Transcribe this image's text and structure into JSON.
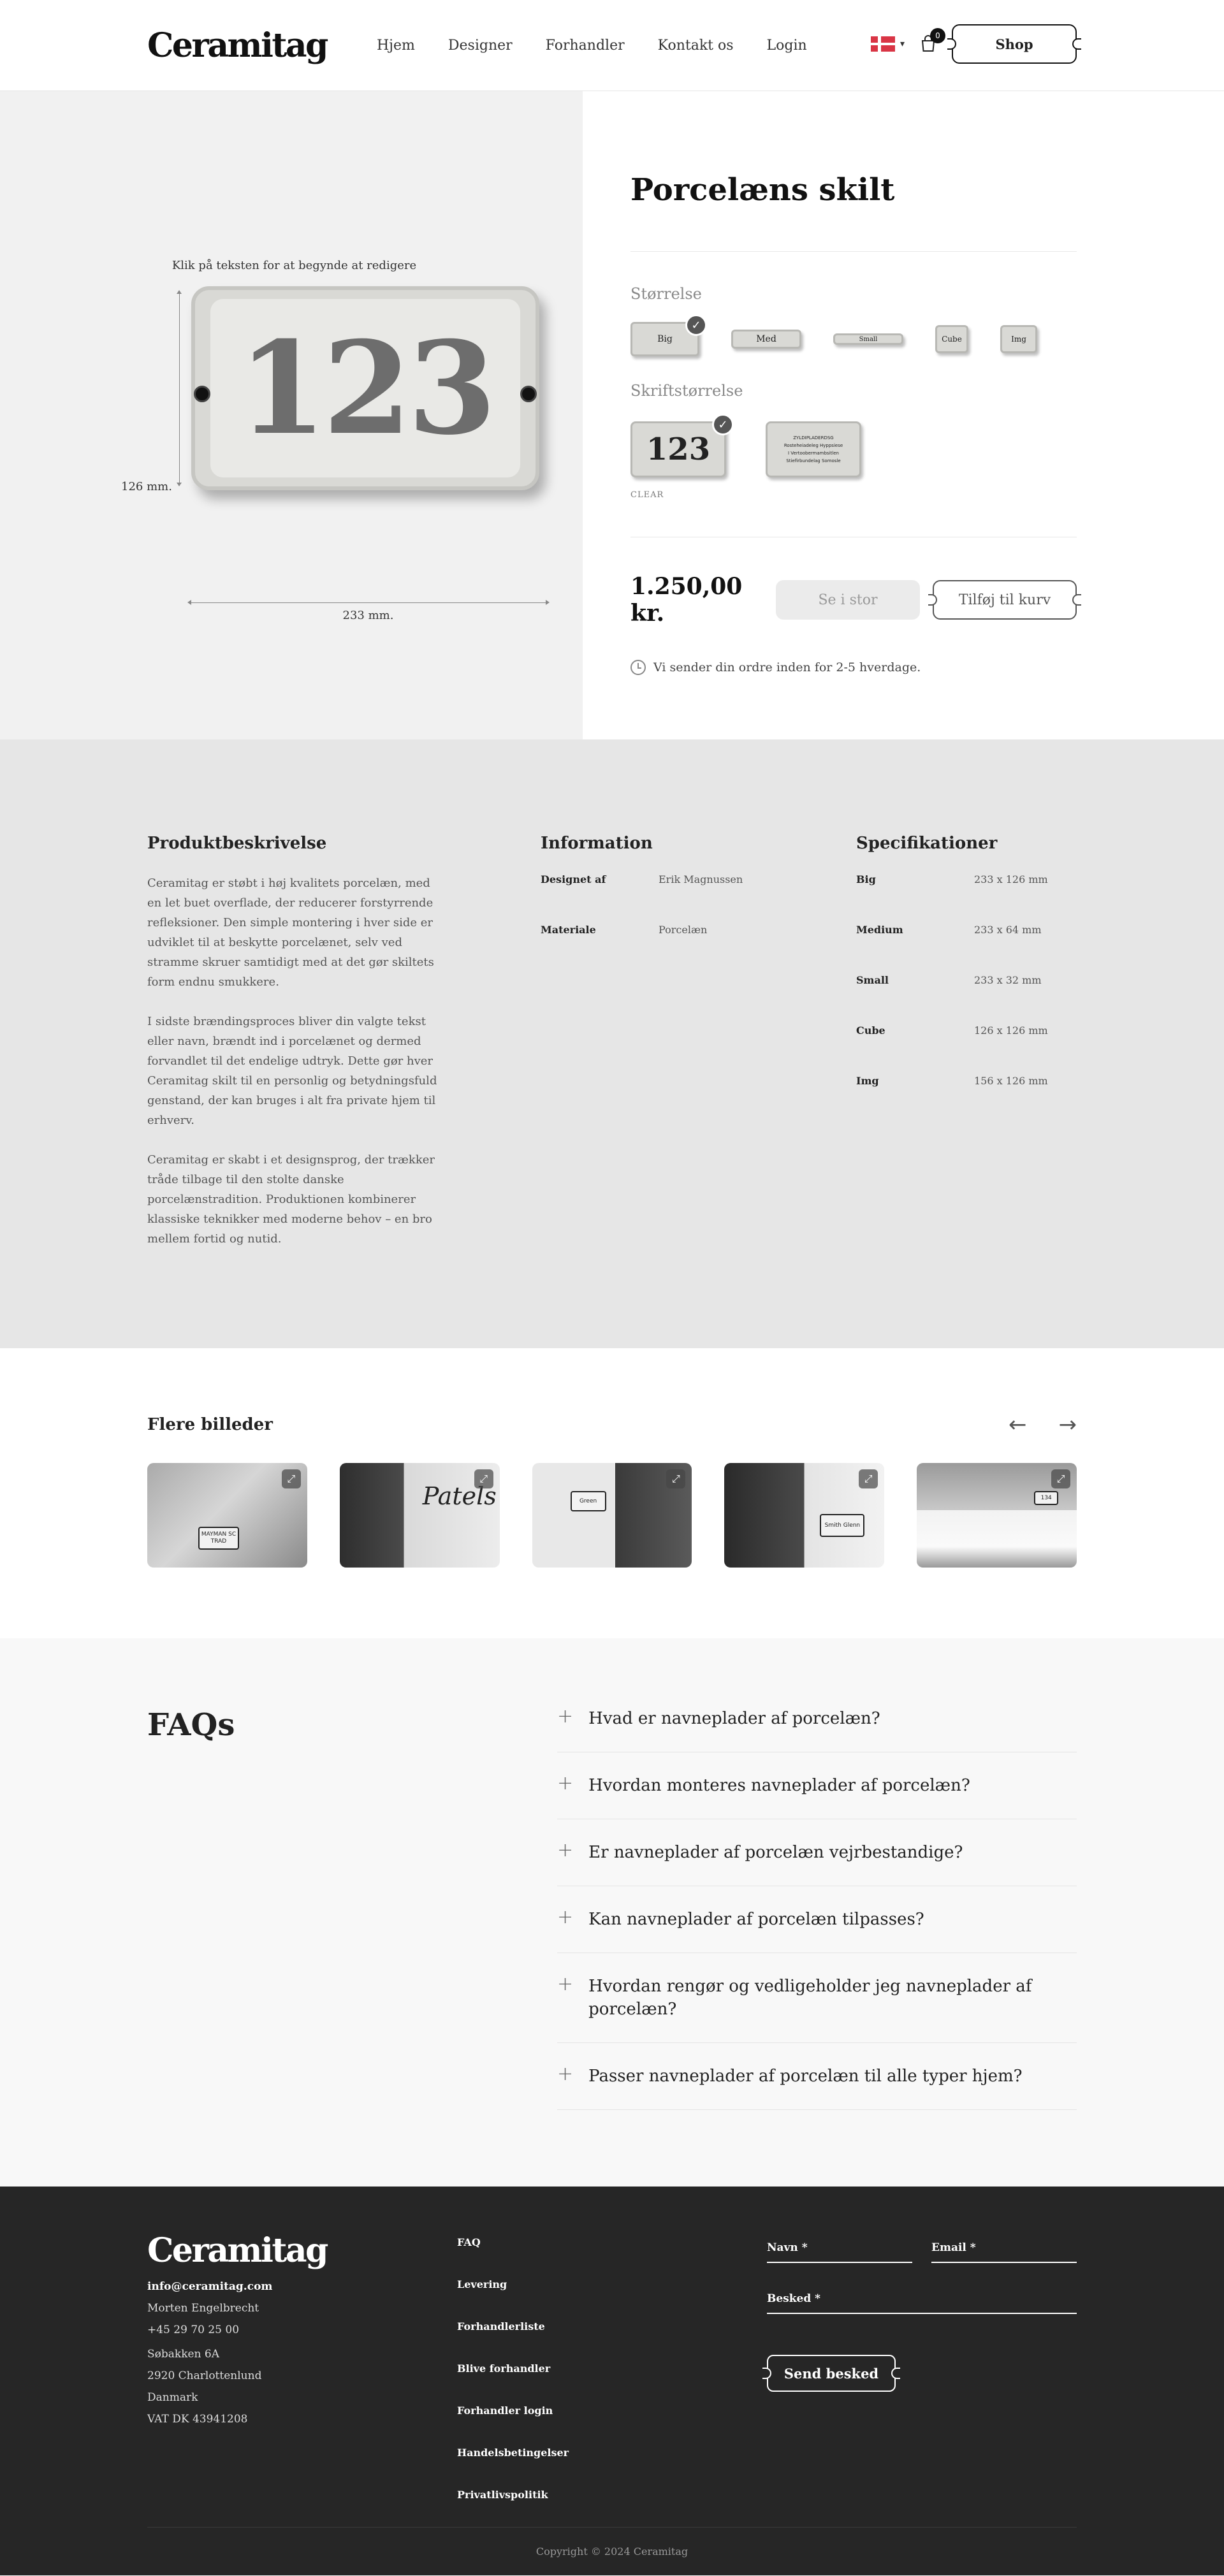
{
  "header": {
    "logo": "Ceramitag",
    "nav": [
      "Hjem",
      "Designer",
      "Forhandler",
      "Kontakt os",
      "Login"
    ],
    "cart_count": "0",
    "shop_label": "Shop"
  },
  "product": {
    "click_hint": "Klik på teksten for at begynde at redigere",
    "plate_number": "123",
    "height_label": "126 mm.",
    "width_label": "233 mm.",
    "title": "Porcelæns skilt",
    "size_label": "Størrelse",
    "sizes": [
      "Big",
      "Med",
      "Small",
      "Cube",
      "Img"
    ],
    "font_size_label": "Skriftstørrelse",
    "font_big": "123",
    "font_small_lines": [
      "ZYLDIPLADERDSG",
      "Rosteheiadeleg Hyppsiese",
      "I Vertoobermambsitlen",
      "Stiefirbundelag Somosle"
    ],
    "clear_label": "CLEAR",
    "price": "1.250,00 kr.",
    "stock_btn": "Se i stor",
    "cart_btn": "Tilføj til kurv",
    "shipping": "Vi sender din ordre inden for 2-5 hverdage."
  },
  "description": {
    "title": "Produktbeskrivelse",
    "paragraphs": [
      "Ceramitag er støbt i høj kvalitets porcelæn, med en let buet overflade, der reducerer forstyrrende refleksioner. Den simple montering i hver side er udviklet til at beskytte porcelænet, selv ved stramme skruer samtidigt med at det gør skiltets form endnu smukkere.",
      "I sidste brændingsproces bliver din valgte tekst eller navn, brændt ind i porcelænet og dermed forvandlet til det endelige udtryk. Dette gør hver Ceramitag skilt til en personlig og betydningsfuld genstand, der kan bruges i alt fra private hjem til erhverv.",
      "Ceramitag er skabt i et designsprog, der trækker tråde tilbage til den stolte danske porcelænstradition. Produktionen kombinerer klassiske teknikker med moderne behov – en bro mellem fortid og nutid."
    ],
    "info_title": "Information",
    "info": [
      {
        "k": "Designet af",
        "v": "Erik Magnussen"
      },
      {
        "k": "Materiale",
        "v": "Porcelæn"
      }
    ],
    "spec_title": "Specifikationer",
    "specs": [
      {
        "k": "Big",
        "v": "233 x 126 mm"
      },
      {
        "k": "Medium",
        "v": "233 x 64 mm"
      },
      {
        "k": "Small",
        "v": "233 x 32 mm"
      },
      {
        "k": "Cube",
        "v": "126 x 126 mm"
      },
      {
        "k": "Img",
        "v": "156 x 126 mm"
      }
    ]
  },
  "gallery": {
    "title": "Flere billeder",
    "prev": "←",
    "next": "→",
    "expand_icon": "⤢",
    "sign_texts": [
      "MAYMAN SC TRAD",
      "Patels",
      "Green",
      "Smith Glenn",
      "134"
    ]
  },
  "faq": {
    "title": "FAQs",
    "questions": [
      "Hvad er navneplader af porcelæn?",
      "Hvordan monteres navneplader af porcelæn?",
      "Er navneplader af porcelæn vejrbestandige?",
      "Kan navneplader af porcelæn tilpasses?",
      "Hvordan rengør og vedligeholder jeg navneplader af porcelæn?",
      "Passer navneplader af porcelæn til alle typer hjem?"
    ]
  },
  "footer": {
    "logo": "Ceramitag",
    "email": "info@ceramitag.com",
    "name": "Morten Engelbrecht",
    "phone": "+45 29 70 25 00",
    "address": [
      "Søbakken 6A",
      "2920 Charlottenlund",
      "Danmark",
      "VAT DK 43941208"
    ],
    "links": [
      "FAQ",
      "Levering",
      "Forhandlerliste",
      "Blive forhandler",
      "Forhandler login",
      "Handelsbetingelser",
      "Privatlivspolitik"
    ],
    "form_name": "Navn *",
    "form_email": "Email *",
    "form_message": "Besked *",
    "send_label": "Send besked",
    "copyright": "Copyright © 2024 Ceramitag"
  },
  "colors": {
    "dark": "#262626",
    "grey_bg": "#e6e6e6",
    "light_bg": "#f1f1f1",
    "flag_red": "#d93545"
  }
}
